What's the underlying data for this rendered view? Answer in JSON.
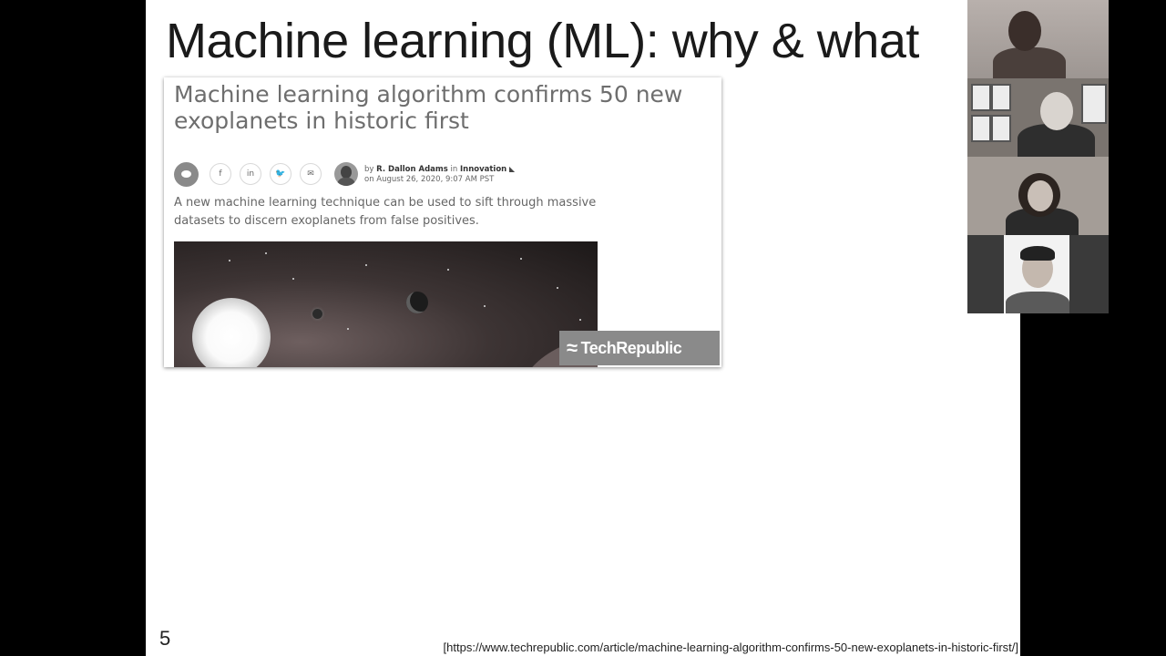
{
  "slide": {
    "title": "Machine learning (ML): why & what",
    "number": "5",
    "source": "[https://www.techrepublic.com/article/machine-learning-algorithm-confirms-50-new-exoplanets-in-historic-first/]"
  },
  "article": {
    "headline": "Machine learning algorithm confirms 50 new exoplanets in historic first",
    "byline_by": "by",
    "author": "R. Dallon Adams",
    "byline_in": "in",
    "category": "Innovation",
    "date": "on August 26, 2020, 9:07 AM PST",
    "summary": "A new machine learning technique can be used to sift through massive datasets to discern exoplanets from false positives.",
    "social": [
      "f",
      "in",
      "🐦",
      "✉"
    ],
    "logo_text": "TechRepublic"
  },
  "icons": {
    "comment": "comment-icon",
    "facebook": "facebook-icon",
    "linkedin": "linkedin-icon",
    "twitter": "twitter-icon",
    "email": "email-icon",
    "rss": "rss-icon"
  },
  "colors": {
    "slide_background": "#ffffff",
    "outer_background": "#000000",
    "headline": "#6e6e6e"
  }
}
